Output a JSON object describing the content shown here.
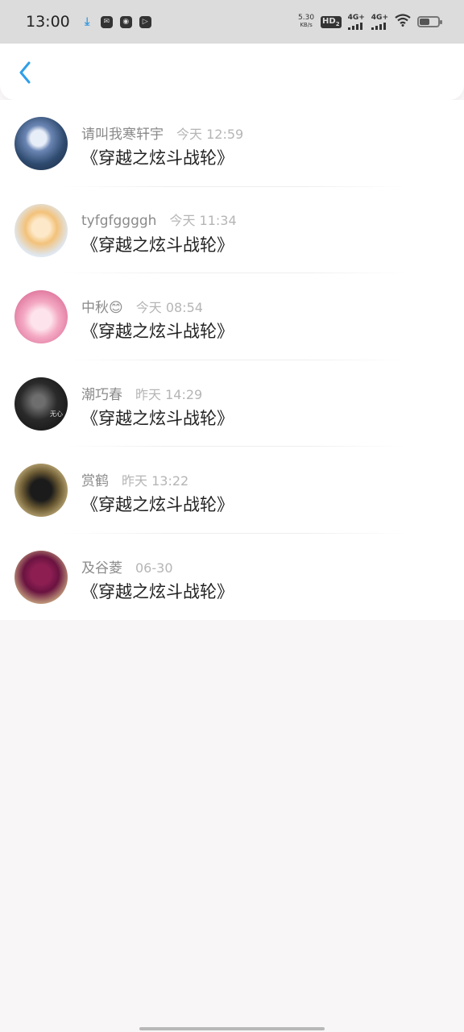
{
  "status_bar": {
    "time": "13:00",
    "net_speed_value": "5.30",
    "net_speed_unit": "KB/s",
    "hd_label": "HD",
    "hd_sub": "2",
    "sim1_label": "4G+",
    "sim2_label": "4G+",
    "icons": [
      "download-icon",
      "mail-icon",
      "record-icon",
      "play-icon",
      "wifi-icon",
      "battery-icon"
    ]
  },
  "header": {
    "back_icon": "chevron-left-icon",
    "accent_color": "#2f9fe8"
  },
  "messages": [
    {
      "name": "请叫我寒轩宇",
      "time": "今天 12:59",
      "text": "《穿越之炫斗战轮》"
    },
    {
      "name": "tyfgfggggh",
      "time": "今天 11:34",
      "text": "《穿越之炫斗战轮》"
    },
    {
      "name": "中秋😊",
      "time": "今天 08:54",
      "text": "《穿越之炫斗战轮》"
    },
    {
      "name": "潮巧春",
      "time": "昨天 14:29",
      "text": "《穿越之炫斗战轮》",
      "avatar_caption": "无心"
    },
    {
      "name": "赏鹤",
      "time": "昨天 13:22",
      "text": "《穿越之炫斗战轮》"
    },
    {
      "name": "及谷菱",
      "time": "06-30",
      "text": "《穿越之炫斗战轮》"
    }
  ]
}
